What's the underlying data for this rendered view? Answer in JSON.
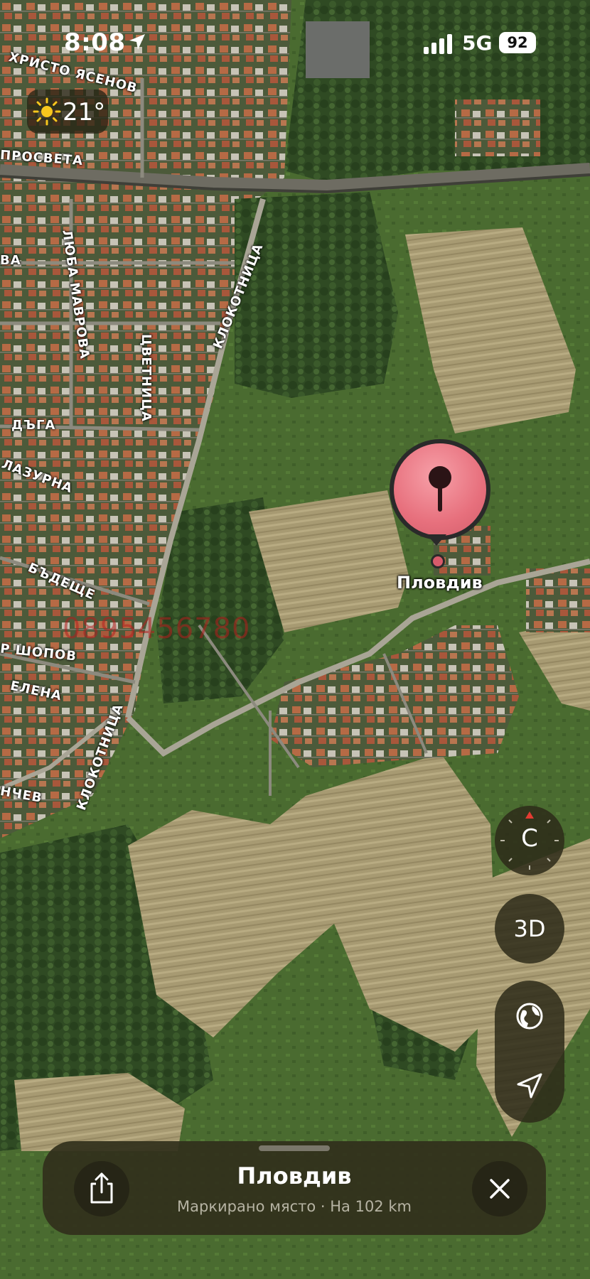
{
  "status_bar": {
    "time": "8:08",
    "network": "5G",
    "battery": "92"
  },
  "weather": {
    "temperature": "21°",
    "icon": "sun-icon"
  },
  "map": {
    "streets": [
      {
        "id": "yasenov",
        "label": "ХРИСТО ЯСЕНОВ"
      },
      {
        "id": "prosveta",
        "label": "ПРОСВЕТА"
      },
      {
        "id": "va",
        "label": "ВА"
      },
      {
        "id": "luba",
        "label": "ЛЮБА МАВРОВА"
      },
      {
        "id": "tsvetnitsa",
        "label": "ЦВЕТНИЦА"
      },
      {
        "id": "klokotnitsa1",
        "label": "КЛОКОТНИЦА"
      },
      {
        "id": "daga",
        "label": "ДЪГА"
      },
      {
        "id": "lazurna",
        "label": "ЛАЗУРНА"
      },
      {
        "id": "badeshte",
        "label": "БЪДЕЩЕ"
      },
      {
        "id": "shopov",
        "label": "Р ШОПОВ"
      },
      {
        "id": "elena",
        "label": "ЕЛЕНА"
      },
      {
        "id": "klokotnitsa2",
        "label": "КЛОКОТНИЦА"
      },
      {
        "id": "ncheve",
        "label": "НЧЕВ"
      }
    ],
    "watermark": "0895456780",
    "pin": {
      "label": "Пловдив",
      "icon": "map-pin-icon",
      "color": "#e7707d"
    }
  },
  "controls": {
    "compass_label": "С",
    "view_3d_label": "3D",
    "globe_icon": "globe-icon",
    "location_icon": "location-arrow-icon"
  },
  "place_sheet": {
    "title": "Пловдив",
    "subtitle": "Маркирано място · На 102 km",
    "share_icon": "share-icon",
    "close_icon": "close-icon"
  }
}
